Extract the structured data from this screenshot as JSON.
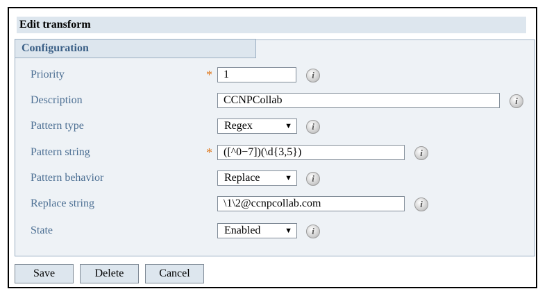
{
  "header": {
    "title": "Edit transform"
  },
  "section": {
    "legend": "Configuration"
  },
  "fields": {
    "priority": {
      "label": "Priority",
      "value": "1"
    },
    "description": {
      "label": "Description",
      "value": "CCNPCollab"
    },
    "pattern_type": {
      "label": "Pattern type",
      "value": "Regex"
    },
    "pattern_string": {
      "label": "Pattern string",
      "value": "([^0−7])(\\d{3,5})"
    },
    "pattern_behavior": {
      "label": "Pattern behavior",
      "value": "Replace"
    },
    "replace_string": {
      "label": "Replace string",
      "value": "\\1\\2@ccnpcollab.com"
    },
    "state": {
      "label": "State",
      "value": "Enabled"
    }
  },
  "required_marker": "*",
  "info_glyph": "i",
  "dropdown_arrow": "▼",
  "buttons": {
    "save": "Save",
    "delete": "Delete",
    "cancel": "Cancel"
  },
  "icons": {
    "info": "info-icon",
    "required": "required-asterisk",
    "dropdown": "chevron-down-icon"
  },
  "colors": {
    "label": "#4c6f93",
    "legend": "#3a5f86",
    "required": "#e07a20",
    "panel": "#eef2f6",
    "header": "#dde6ee"
  }
}
